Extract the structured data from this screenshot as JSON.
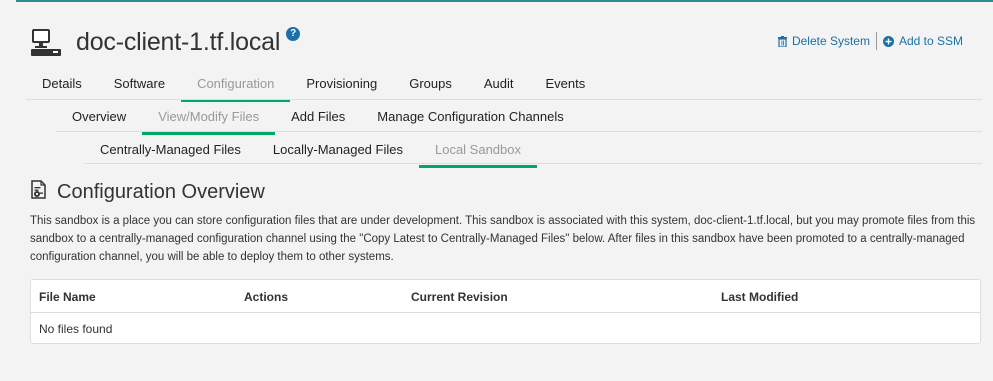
{
  "header": {
    "title": "doc-client-1.tf.local",
    "help_icon": "question-circle-icon",
    "system_icon": "desktop-system-icon"
  },
  "actions": {
    "delete_label": "Delete System",
    "delete_icon": "trash-icon",
    "ssm_label": "Add to SSM",
    "ssm_icon": "plus-circle-icon"
  },
  "tabs_main": [
    {
      "label": "Details"
    },
    {
      "label": "Software"
    },
    {
      "label": "Configuration",
      "active": true
    },
    {
      "label": "Provisioning"
    },
    {
      "label": "Groups"
    },
    {
      "label": "Audit"
    },
    {
      "label": "Events"
    }
  ],
  "tabs_config": [
    {
      "label": "Overview"
    },
    {
      "label": "View/Modify Files",
      "active": true
    },
    {
      "label": "Add Files"
    },
    {
      "label": "Manage Configuration Channels"
    }
  ],
  "tabs_files": [
    {
      "label": "Centrally-Managed Files"
    },
    {
      "label": "Locally-Managed Files"
    },
    {
      "label": "Local Sandbox",
      "active": true
    }
  ],
  "section": {
    "title": "Configuration Overview",
    "icon": "config-file-icon",
    "description": "This sandbox is a place you can store configuration files that are under development. This sandbox is associated with this system, doc-client-1.tf.local, but you may promote files from this sandbox to a centrally-managed configuration channel using the \"Copy Latest to Centrally-Managed Files\" below. After files in this sandbox have been promoted to a centrally-managed configuration channel, you will be able to deploy them to other systems."
  },
  "table": {
    "columns": [
      "File Name",
      "Actions",
      "Current Revision",
      "Last Modified"
    ],
    "empty_text": "No files found"
  },
  "colors": {
    "accent": "#00a866",
    "link": "#1b70a8",
    "top_line": "#2d8b8a"
  }
}
